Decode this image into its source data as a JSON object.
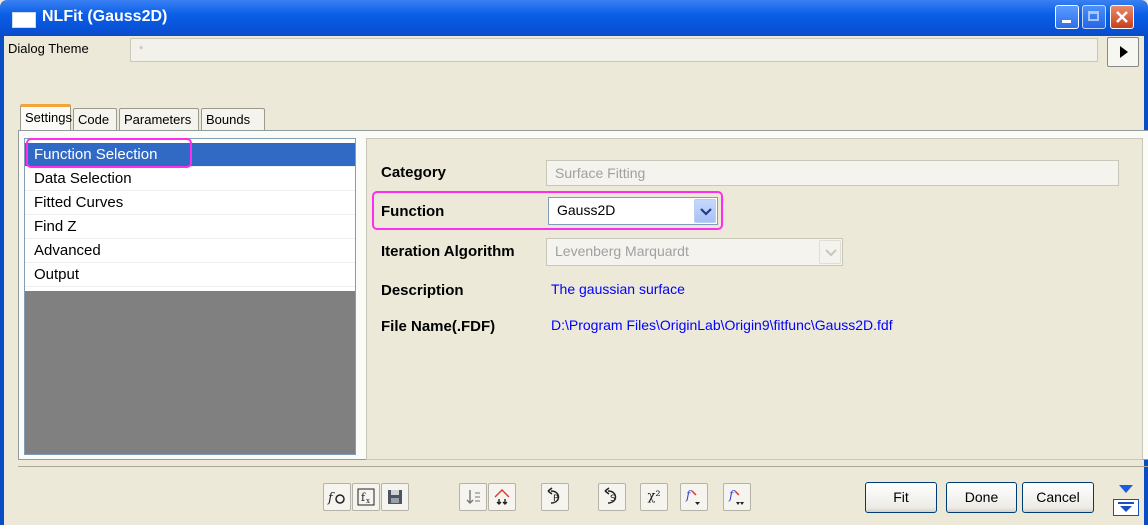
{
  "window": {
    "title": "NLFit (Gauss2D)"
  },
  "theme": {
    "label": "Dialog Theme",
    "value": "*"
  },
  "tabs": [
    {
      "label": "Settings",
      "active": true
    },
    {
      "label": "Code"
    },
    {
      "label": "Parameters"
    },
    {
      "label": "Bounds"
    }
  ],
  "nav": {
    "items": [
      {
        "label": "Function Selection",
        "selected": true
      },
      {
        "label": "Data Selection"
      },
      {
        "label": "Fitted Curves"
      },
      {
        "label": "Find Z"
      },
      {
        "label": "Advanced"
      },
      {
        "label": "Output"
      }
    ]
  },
  "form": {
    "category_label": "Category",
    "category_value": "Surface Fitting",
    "function_label": "Function",
    "function_value": "Gauss2D",
    "iteration_label": "Iteration Algorithm",
    "iteration_value": "Levenberg Marquardt",
    "description_label": "Description",
    "description_value": "The gaussian surface",
    "filename_label": "File Name(.FDF)",
    "filename_value": "D:\\Program Files\\OriginLab\\Origin9\\fitfunc\\Gauss2D.fdf"
  },
  "toolbar": {
    "icons": [
      "function-builder-icon",
      "fx-edit-icon",
      "save-icon",
      "sort-order-icon",
      "fitting-multi-icon",
      "p-undo-icon",
      "s-undo-icon",
      "chi-square-icon",
      "fit-until-converge-icon",
      "fit-one-iteration-icon"
    ],
    "chi_label": "χ²"
  },
  "buttons": {
    "fit": "Fit",
    "done": "Done",
    "cancel": "Cancel"
  },
  "colors": {
    "highlight": "#ff2df0",
    "selection": "#316ac5",
    "link": "#0000ff"
  }
}
